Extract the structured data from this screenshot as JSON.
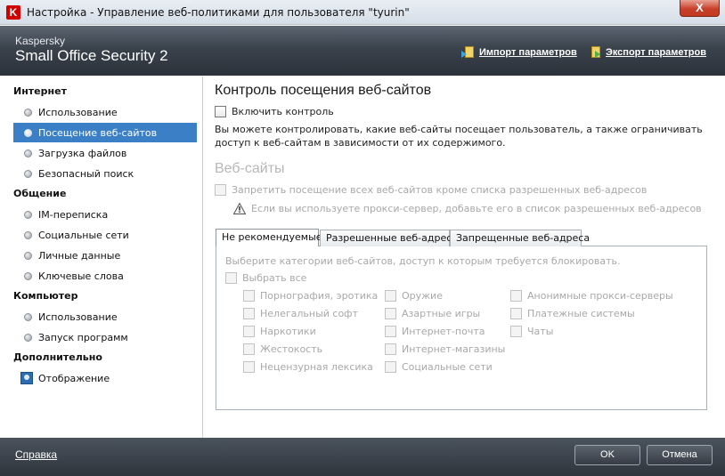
{
  "window": {
    "title": "Настройка - Управление веб-политиками для пользователя \"tyurin\"",
    "close_label": "X",
    "app_icon_letter": "K"
  },
  "header": {
    "brand_line1": "Kaspersky",
    "brand_line2": "Small Office Security 2",
    "import_label": "Импорт параметров",
    "export_label": "Экспорт параметров"
  },
  "sidebar": {
    "groups": [
      "Интернет",
      "Общение",
      "Компьютер",
      "Дополнительно"
    ],
    "items": [
      {
        "label": "Использование",
        "selected": false
      },
      {
        "label": "Посещение веб-сайтов",
        "selected": true
      },
      {
        "label": "Загрузка файлов",
        "selected": false
      },
      {
        "label": "Безопасный поиск",
        "selected": false
      },
      {
        "label": "IM-переписка",
        "selected": false
      },
      {
        "label": "Социальные сети",
        "selected": false
      },
      {
        "label": "Личные данные",
        "selected": false
      },
      {
        "label": "Ключевые слова",
        "selected": false
      },
      {
        "label": "Использование",
        "selected": false
      },
      {
        "label": "Запуск программ",
        "selected": false
      },
      {
        "label": "Отображение",
        "selected": false
      }
    ]
  },
  "main": {
    "title": "Контроль посещения веб-сайтов",
    "enable_label": "Включить контроль",
    "enable_checked": false,
    "description": "Вы можете контролировать, какие веб-сайты посещает пользователь, а также ограничивать доступ к веб-сайтам в зависимости от их содержимого.",
    "section_title": "Веб-сайты",
    "block_all_label": "Запретить посещение всех веб-сайтов кроме списка разрешенных веб-адресов",
    "proxy_hint": "Если вы используете прокси-сервер, добавьте его в список разрешенных веб-адресов",
    "tabs": [
      "Не рекомендуемые",
      "Разрешенные веб-адреса",
      "Запрещенные веб-адреса"
    ],
    "active_tab": 0,
    "categories_hint": "Выберите категории веб-сайтов, доступ к которым требуется блокировать.",
    "select_all_label": "Выбрать все",
    "categories": [
      [
        "Порнография, эротика",
        "Нелегальный софт",
        "Наркотики",
        "Жестокость",
        "Нецензурная лексика"
      ],
      [
        "Оружие",
        "Азартные игры",
        "Интернет-почта",
        "Интернет-магазины",
        "Социальные сети"
      ],
      [
        "Анонимные прокси-серверы",
        "Платежные системы",
        "Чаты"
      ]
    ]
  },
  "footer": {
    "help_label": "Справка",
    "ok_label": "OK",
    "cancel_label": "Отмена"
  }
}
